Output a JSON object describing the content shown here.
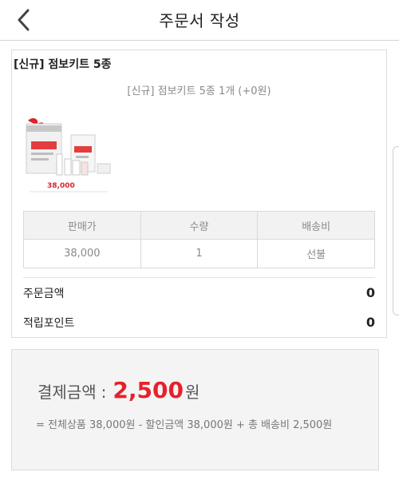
{
  "header": {
    "title": "주문서 작성",
    "back_icon": "chevron-left-icon"
  },
  "product": {
    "name": "[신규] 점보키트 5종",
    "option_text": "[신규] 점보키트 5종 1개 (+0원)",
    "thumbnail_price_label": "38,000"
  },
  "table": {
    "headers": [
      "판매가",
      "수량",
      "배송비"
    ],
    "row": [
      "38,000",
      "1",
      "선불"
    ]
  },
  "summary": {
    "order_amount_label": "주문금액",
    "order_amount_value": "0",
    "points_label": "적립포인트",
    "points_value": "0"
  },
  "payment": {
    "label": "결제금액",
    "colon": ":",
    "amount": "2,500",
    "unit": "원",
    "detail": "= 전체상품 38,000원 - 할인금액 38,000원 + 총 배송비 2,500원"
  },
  "colors": {
    "accent_red": "#e8202a",
    "table_header_bg": "#f2f2f2",
    "payment_bg": "#f4f4f4"
  }
}
